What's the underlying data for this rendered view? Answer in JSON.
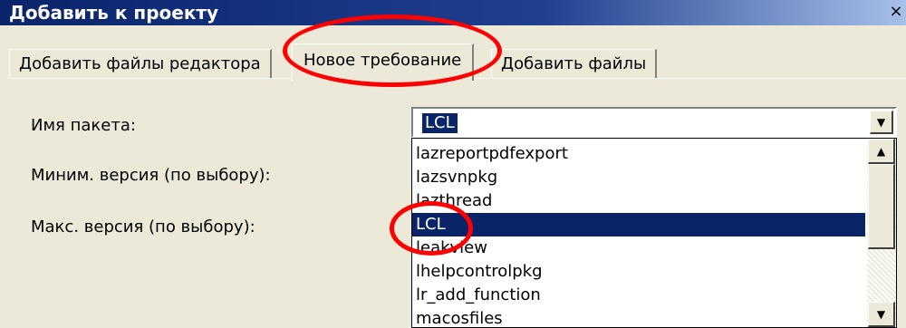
{
  "window": {
    "title": "Добавить к проекту",
    "close_glyph": "×"
  },
  "tabs": [
    {
      "label": "Добавить файлы редактора",
      "active": false
    },
    {
      "label": "Новое требование",
      "active": true
    },
    {
      "label": "Добавить файлы",
      "active": false
    }
  ],
  "form": {
    "package_name_label": "Имя пакета:",
    "min_version_label": "Миним. версия (по выбору):",
    "max_version_label": "Макс. версия (по выбору):",
    "package_value": "LCL"
  },
  "dropdown": {
    "items": [
      "lazreportpdfexport",
      "lazsvnpkg",
      "lazthread",
      "LCL",
      "leakview",
      "lhelpcontrolpkg",
      "lr_add_function",
      "macosfiles"
    ],
    "selected_index": 3
  },
  "icons": {
    "combo_arrow": "▼",
    "scroll_up": "▲",
    "scroll_down": "▼"
  },
  "colors": {
    "title_bar": "#0a246a",
    "selection": "#0a246a",
    "annotation": "#ff0000",
    "dialog_bg": "#ece9d8"
  }
}
